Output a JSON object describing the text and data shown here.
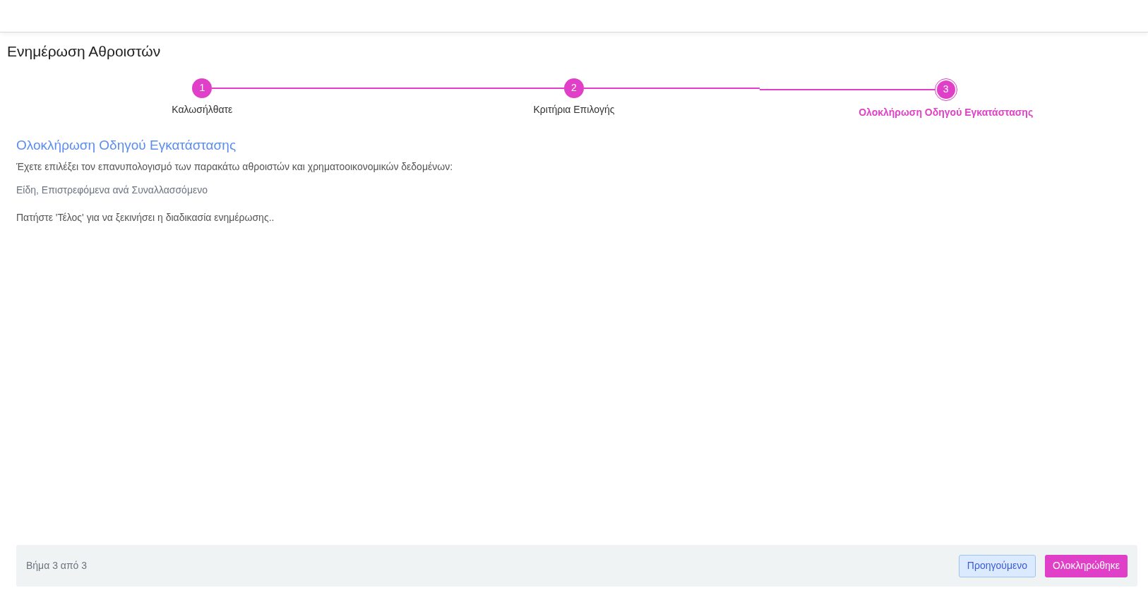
{
  "page_title": "Ενημέρωση Αθροιστών",
  "steps": [
    {
      "number": "1",
      "label": "Καλωσήλθατε",
      "selected": false
    },
    {
      "number": "2",
      "label": "Κριτήρια Επιλογής",
      "selected": false
    },
    {
      "number": "3",
      "label": "Ολοκλήρωση Οδηγού Εγκατάστασης",
      "selected": true
    }
  ],
  "content": {
    "heading": "Ολοκλήρωση Οδηγού Εγκατάστασης",
    "intro": "Έχετε επιλέξει τον επανυπολογισμό των παρακάτω αθροιστών και χρηματοοικονομικών δεδομένων:",
    "selection": "Είδη, Επιστρεφόμενα ανά Συναλλασσόμενο",
    "instruction": "Πατήστε 'Τέλος' για να ξεκινήσει η διαδικασία ενημέρωσης.."
  },
  "footer": {
    "step_text": "Βήμα 3 από 3",
    "previous_button": "Προηγούμενο",
    "finish_button": "Ολοκληρώθηκε"
  }
}
